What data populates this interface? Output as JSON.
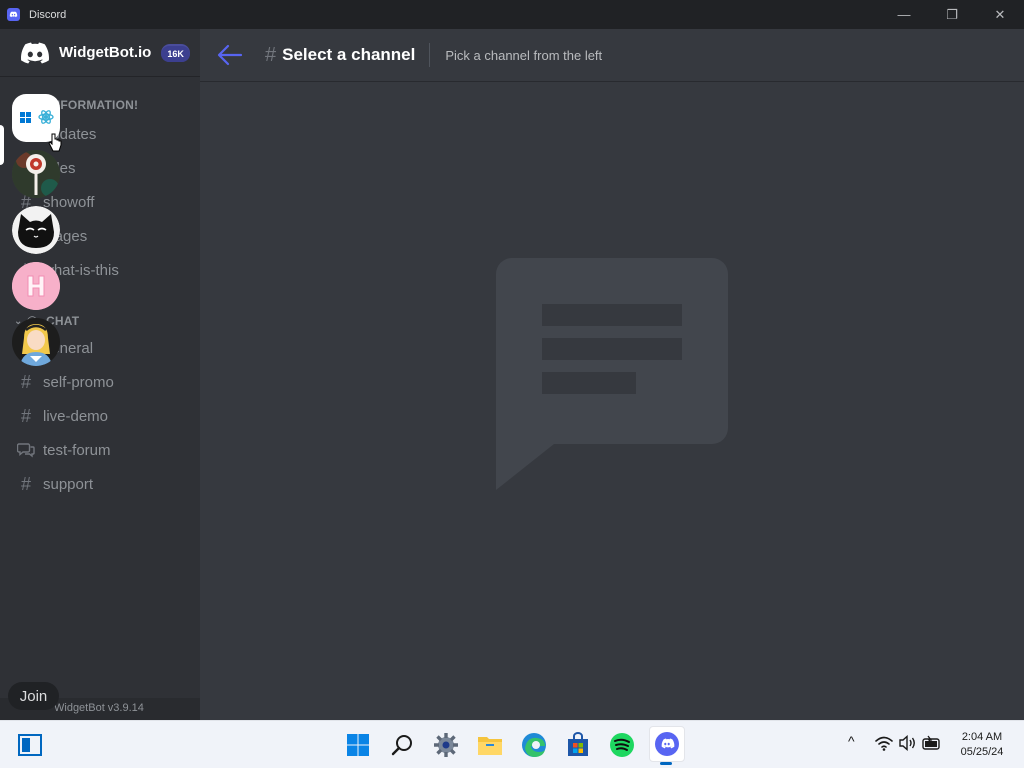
{
  "window": {
    "title": "Discord",
    "minimize_glyph": "—",
    "restore_glyph": "❐",
    "close_glyph": "✕"
  },
  "guild": {
    "name": "WidgetBot.io",
    "member_badge": "16K"
  },
  "categories": [
    {
      "label": "INFORMATION!"
    },
    {
      "label": "CHAT"
    }
  ],
  "channels": [
    {
      "name": "updates",
      "icon": "hash-icon"
    },
    {
      "name": "rules",
      "icon": "hash-icon"
    },
    {
      "name": "showoff",
      "icon": "hash-icon"
    },
    {
      "name": "stages",
      "icon": "hash-icon"
    },
    {
      "name": "what-is-this",
      "icon": "hash-icon"
    },
    {
      "name": "general",
      "icon": "hash-icon"
    },
    {
      "name": "self-promo",
      "icon": "hash-icon"
    },
    {
      "name": "live-demo",
      "icon": "hash-icon"
    },
    {
      "name": "test-forum",
      "icon": "forum-icon"
    },
    {
      "name": "support",
      "icon": "hash-icon"
    }
  ],
  "footer": {
    "join_label": "Join",
    "version": "WidgetBot v3.9.14"
  },
  "topbar": {
    "hash": "#",
    "title": "Select a channel",
    "topic": "Pick a channel from the left"
  },
  "servers": [
    {
      "name": "server-widgetbot-react",
      "active": true
    },
    {
      "name": "server-lollipop"
    },
    {
      "name": "server-black-cat"
    },
    {
      "name": "server-pink-h"
    },
    {
      "name": "server-alice"
    }
  ],
  "taskbar": {
    "apps": [
      "start-icon",
      "search-icon",
      "settings-icon",
      "file-explorer-icon",
      "edge-icon",
      "store-icon",
      "spotify-icon",
      "discord-icon"
    ],
    "tray_chevron": "^"
  },
  "clock": {
    "time": "2:04 AM",
    "date": "05/25/24"
  },
  "colors": {
    "accent": "#5865f2",
    "sidebar": "#2f3136",
    "main": "#36393f",
    "titlebar": "#202225"
  }
}
